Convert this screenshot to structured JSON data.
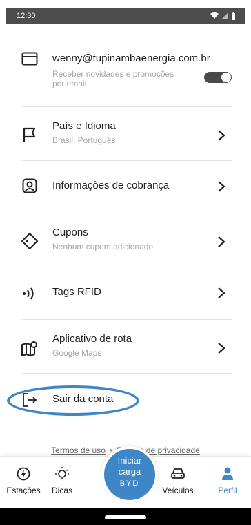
{
  "status_bar": {
    "time": "12:30",
    "icons": [
      "wifi-icon",
      "signal-icon",
      "battery-icon"
    ]
  },
  "settings": {
    "email": {
      "address": "wenny@tupinambaenergia.com.br",
      "newsletter_line1": "Receber novidades e promoções",
      "newsletter_line2": "por email",
      "toggle_on": true
    },
    "items": [
      {
        "label": "País e Idioma",
        "sub": "Brasil, Português",
        "icon": "flag-icon"
      },
      {
        "label": "Informações de cobrança",
        "sub": "",
        "icon": "billing-icon"
      },
      {
        "label": "Cupons",
        "sub": "Nenhum cupom adicionado",
        "icon": "coupon-icon"
      },
      {
        "label": "Tags RFID",
        "sub": "",
        "icon": "rfid-icon"
      },
      {
        "label": "Aplicativo de rota",
        "sub": "Google Maps",
        "icon": "map-icon"
      }
    ],
    "logout_label": "Sair da conta"
  },
  "footer": {
    "terms": "Termos de uso",
    "separator": "•",
    "privacy": "Política de privacidade"
  },
  "tabbar": {
    "tabs": [
      {
        "label": "Estações",
        "icon": "charging-station-icon"
      },
      {
        "label": "Dicas",
        "icon": "lightbulb-icon"
      },
      {
        "label": "Veículos",
        "icon": "car-icon"
      },
      {
        "label": "Perfil",
        "icon": "profile-icon",
        "active": true
      }
    ],
    "fab_line1": "Iniciar",
    "fab_line2": "carga",
    "fab_brand": "BYD"
  },
  "colors": {
    "accent": "#3f86c7",
    "toggle": "#4a4a4a",
    "divider": "#e6e6e6"
  }
}
